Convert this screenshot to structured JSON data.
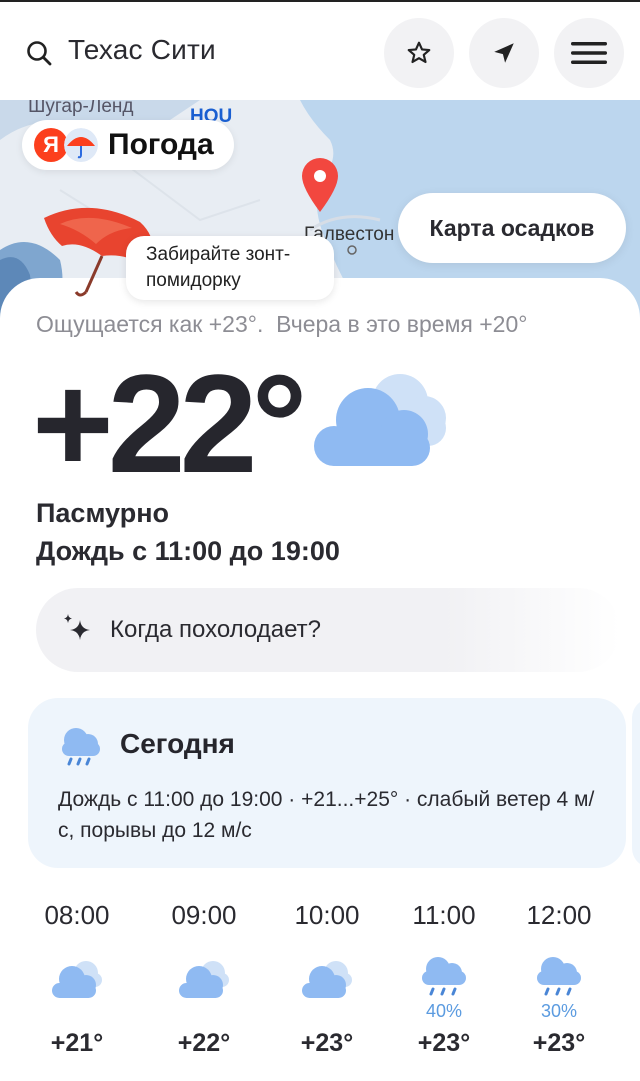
{
  "header": {
    "city": "Техас Сити",
    "icons": [
      "search-icon",
      "star-icon",
      "location-arrow-icon",
      "menu-icon"
    ]
  },
  "map": {
    "logo_letter": "Я",
    "logo_text": "Погода",
    "label_top": "Шугар-Ленд",
    "label_hou": "HOU",
    "label_city": "Галвестон",
    "precip_button": "Карта осадков",
    "promo_text": "Забирайте зонт-помидорку"
  },
  "current": {
    "feels_like": "Ощущается как +23°.",
    "yesterday": "Вчера в это время +20°",
    "temperature": "+22°",
    "condition": "Пасмурно",
    "rain": "Дождь с 11:00 до 19:00",
    "ask": "Когда похолодает?"
  },
  "today": {
    "title": "Сегодня",
    "description": "Дождь с 11:00 до 19:00 · +21...+25° · слабый ветер 4 м/с, порывы до 12 м/с"
  },
  "hourly": [
    {
      "time": "08:00",
      "icon": "cloud-icon",
      "prob": "",
      "temp": "+21°"
    },
    {
      "time": "09:00",
      "icon": "cloud-icon",
      "prob": "",
      "temp": "+22°"
    },
    {
      "time": "10:00",
      "icon": "cloud-icon",
      "prob": "",
      "temp": "+23°"
    },
    {
      "time": "11:00",
      "icon": "rain-icon",
      "prob": "40%",
      "temp": "+23°"
    },
    {
      "time": "12:00",
      "icon": "rain-icon",
      "prob": "30%",
      "temp": "+23°"
    }
  ],
  "colors": {
    "accent_red": "#fc3f1d",
    "cloud_blue": "#8fbaf2",
    "card_bg": "#eef5fc",
    "prob_blue": "#5b9be0"
  }
}
